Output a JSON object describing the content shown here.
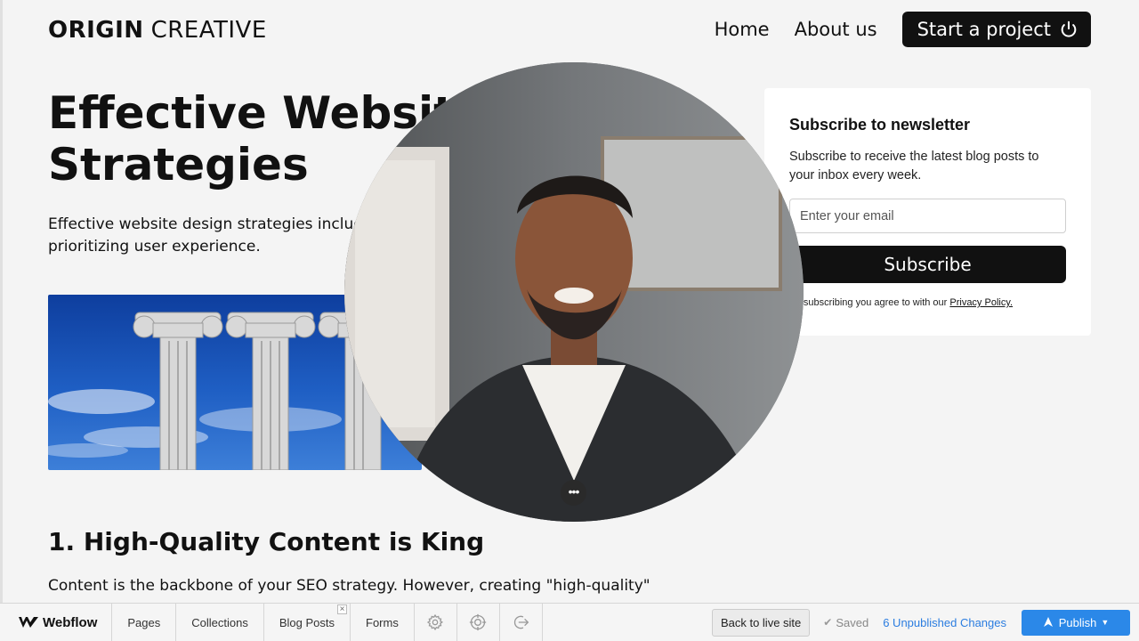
{
  "header": {
    "logo_bold": "ORIGIN",
    "logo_light": "CREATIVE",
    "nav": [
      "Home",
      "About us"
    ],
    "cta_label": "Start a project"
  },
  "article": {
    "title": "Effective Website Design Strategies",
    "intro": "Effective website design strategies include prioritizing user experience.",
    "section_heading": "1. High-Quality Content is King",
    "section_paragraph": "Content is the backbone of your SEO strategy. However, creating \"high-quality\" content..."
  },
  "newsletter": {
    "title": "Subscribe to newsletter",
    "description": "Subscribe to receive the latest blog posts to your inbox every week.",
    "email_placeholder": "Enter your email",
    "button_label": "Subscribe",
    "terms_text": "By subscribing you agree to with our ",
    "privacy_link": "Privacy Policy."
  },
  "webflow_bar": {
    "brand": "Webflow",
    "tabs": [
      "Pages",
      "Collections",
      "Blog Posts",
      "Forms"
    ],
    "back_label": "Back to live site",
    "saved_label": "Saved",
    "unpublished_label": "6 Unpublished Changes",
    "publish_label": "Publish",
    "accent_color": "#2b88e8"
  }
}
